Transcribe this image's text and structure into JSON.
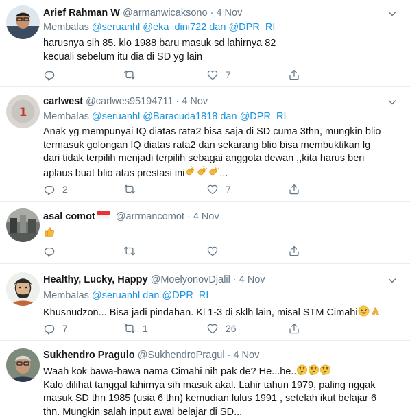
{
  "tweets": [
    {
      "name": "Arief Rahman W",
      "handle": "@armanwicaksono",
      "dot": "·",
      "time": "4 Nov",
      "reply_prefix": "Membalas",
      "reply_users": "@seruanhl @eka_dini722 dan @DPR_RI",
      "text": "harusnya sih 85. klo 1988 baru masuk sd lahirnya 82\nkecuali sebelum itu dia di SD yg lain",
      "replies": "",
      "retweets": "",
      "likes": "7"
    },
    {
      "name": "carlwest",
      "handle": "@carlwes95194711",
      "dot": "·",
      "time": "4 Nov",
      "reply_prefix": "Membalas",
      "reply_users": "@seruanhl @Baracuda1818 dan @DPR_RI",
      "text": "Anak yg mempunyai IQ diatas rata2 bisa saja di SD cuma 3thn, mungkin blio\ntermasuk golongan IQ diatas rata2 dan sekarang blio bisa membuktikan lg\ndari tidak terpilih menjadi terpilih sebagai anggota dewan ,,kita harus beri\naplaus buat blio atas prestasi ini",
      "text_tail": "...",
      "replies": "2",
      "retweets": "",
      "likes": "7"
    },
    {
      "name": "asal comot",
      "handle": "@arrmancomot",
      "dot": "·",
      "time": "4 Nov",
      "replies": "",
      "retweets": "",
      "likes": ""
    },
    {
      "name": "Healthy, Lucky, Happy",
      "handle": "@MoelyonovDjalil",
      "dot": "·",
      "time": "4 Nov",
      "reply_prefix": "Membalas",
      "reply_users": "@seruanhl dan @DPR_RI",
      "text": "Khusnudzon... Bisa jadi pindahan. Kl 1-3 di sklh lain, misal STM Cimahi",
      "replies": "7",
      "retweets": "1",
      "likes": "26"
    },
    {
      "name": "Sukhendro Pragulo",
      "handle": "@SukhendroPragul",
      "dot": "·",
      "time": "4 Nov",
      "text_first": "Waah kok bawa-bawa nama Cimahi nih pak de? He...he..",
      "text": "Kalo dilihat tanggal lahirnya sih masuk akal. Lahir tahun 1979, paling nggak\nmasuk SD thn 1985 (usia 6 thn) kemudian lulus 1991 , setelah ikut belajar 6\nthn. Mungkin salah input awal belajar di SD..."
    }
  ],
  "icons": {
    "reply": "reply-icon",
    "retweet": "retweet-icon",
    "like": "like-icon",
    "share": "share-icon",
    "more": "chevron-down-icon"
  },
  "colors": {
    "link": "#1b95e0",
    "muted": "#657786",
    "divider": "#e6ecf0"
  }
}
